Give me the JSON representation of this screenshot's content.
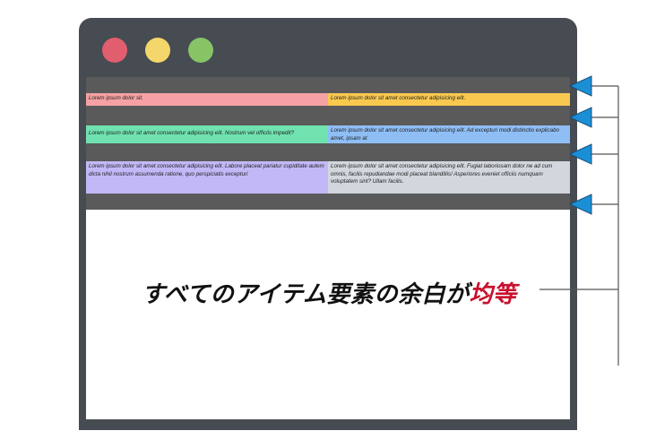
{
  "window": {
    "controls": [
      "close",
      "minimize",
      "maximize"
    ]
  },
  "rows": [
    {
      "left": "Lorem ipsum dolor sit.",
      "right": "Lorem ipsum dolor sit amet consectetur adipisicing elit."
    },
    {
      "left": "Lorem ipsum dolor sit amet consectetur adipisicing elit. Nostrum vel officiis impedit?",
      "right": "Lorem ipsum dolor sit amet consectetur adipisicing elit. Ad excepturi modi distinctio explicabo amet, ipsam at"
    },
    {
      "left": "Lorem ipsum dolor sit amet  consectetur adipisicing elit.  Labore placeat pariatur cupiditate autem dicta nihil  nostrum assumenda ratione,  quo perspiciatis excepturi",
      "right": "Lorem ipsum dolor sit amet  consectetur adipisicing elit. Fugiat laboriosam dolor ne ad cum omnis, facilis  repudiandae modi placeat  blanditiis! Asperiores eveniet officiis numquam  voluptatem sint? Ullam  facilis."
    }
  ],
  "colors": {
    "row1_left": "#f6a1a3",
    "row1_right": "#f9c94f",
    "row2_left": "#6fe2b0",
    "row2_right": "#8fbef5",
    "row3_left": "#c3b8f7",
    "row3_right": "#d2d7dd",
    "gap": "#5a5a5a",
    "arrow": "#1a8fd6",
    "accent_text": "#c8102e"
  },
  "headline": {
    "main": "すべてのアイテム要素の余白が",
    "accent": "均等"
  }
}
